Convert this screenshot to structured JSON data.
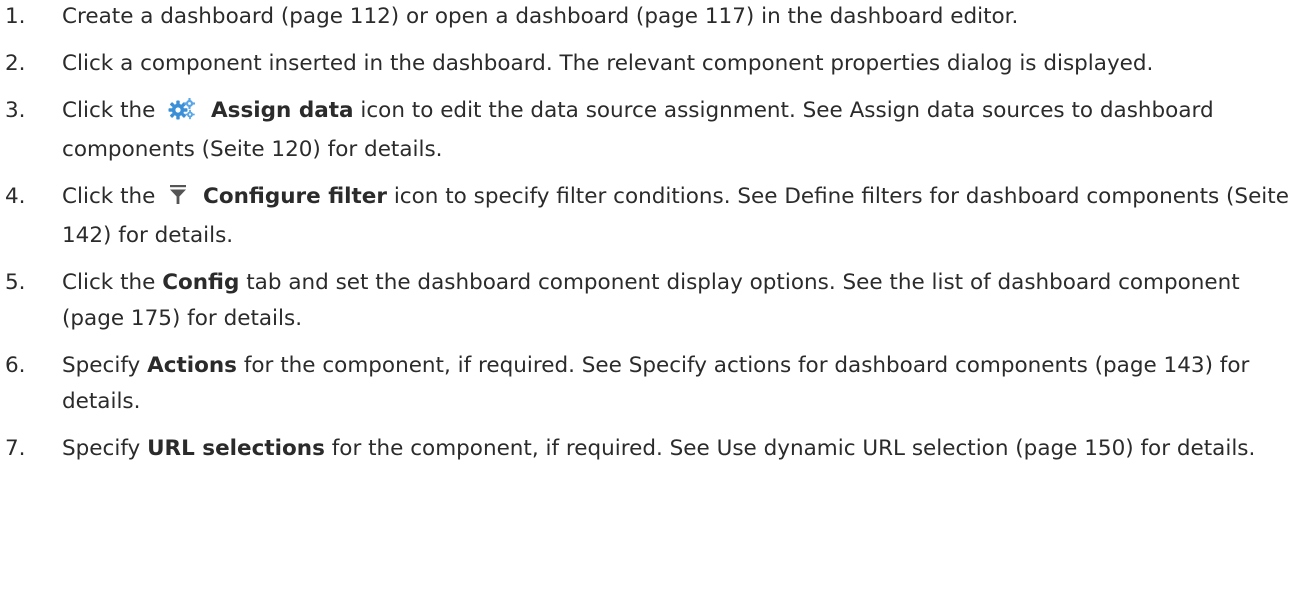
{
  "steps": [
    {
      "number": "1.",
      "text": "Create a dashboard (page 112) or open a dashboard (page 117) in the dashboard editor."
    },
    {
      "number": "2.",
      "text": "Click a component inserted in the dashboard. The relevant component properties dialog is displayed."
    },
    {
      "number": "3.",
      "before": "Click the",
      "icon": "gears-icon",
      "bold": "Assign data",
      "after": "icon to edit the data source assignment. See Assign data sources to dashboard components (Seite 120) for details."
    },
    {
      "number": "4.",
      "before": "Click the",
      "icon": "filter-funnel-icon",
      "bold": "Configure filter",
      "after": "icon to specify filter conditions. See Define filters for dashboard components (Seite 142) for details."
    },
    {
      "number": "5.",
      "before": "Click the",
      "bold": "Config",
      "after": "tab and set the dashboard component display options. See the list of dashboard component (page 175) for details."
    },
    {
      "number": "6.",
      "before": "Specify",
      "bold": "Actions",
      "after": "for the component, if required. See Specify actions for dashboard components (page 143) for details."
    },
    {
      "number": "7.",
      "before": "Specify",
      "bold": "URL selections",
      "after": "for the component, if required. See Use dynamic URL selection (page 150) for details."
    }
  ],
  "colors": {
    "text": "#2b2b2b",
    "gear_icon": "#3a8fd6",
    "filter_icon": "#555555"
  }
}
